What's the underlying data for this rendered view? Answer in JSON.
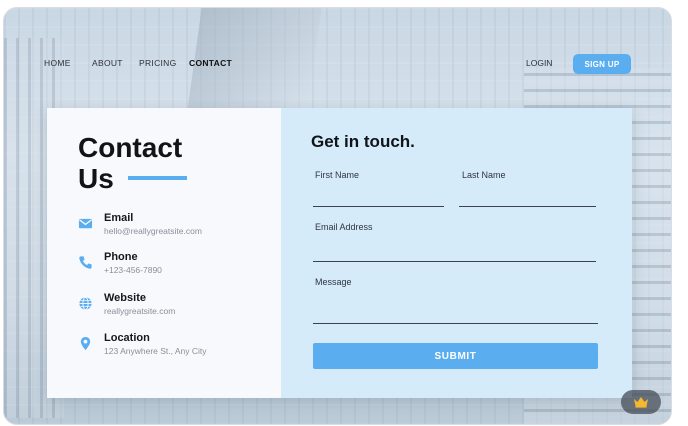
{
  "nav": {
    "links": [
      "HOME",
      "ABOUT",
      "PRICING",
      "CONTACT"
    ],
    "active": "CONTACT",
    "login": "LOGIN",
    "signup": "SIGN UP"
  },
  "left": {
    "title_line1": "Contact",
    "title_line2": "Us",
    "items": [
      {
        "icon": "envelope-icon",
        "label": "Email",
        "value": "hello@reallygreatsite.com"
      },
      {
        "icon": "phone-icon",
        "label": "Phone",
        "value": "+123-456-7890"
      },
      {
        "icon": "globe-icon",
        "label": "Website",
        "value": "reallygreatsite.com"
      },
      {
        "icon": "location-pin-icon",
        "label": "Location",
        "value": "123 Anywhere St., Any City"
      }
    ]
  },
  "form": {
    "title": "Get in touch.",
    "first_name": "First Name",
    "last_name": "Last Name",
    "email": "Email Address",
    "message": "Message",
    "submit": "SUBMIT"
  },
  "colors": {
    "accent": "#5aaef0",
    "right_panel": "#d6ebfa",
    "left_panel": "#f8f9fd"
  },
  "badge": {
    "icon": "crown-icon"
  }
}
